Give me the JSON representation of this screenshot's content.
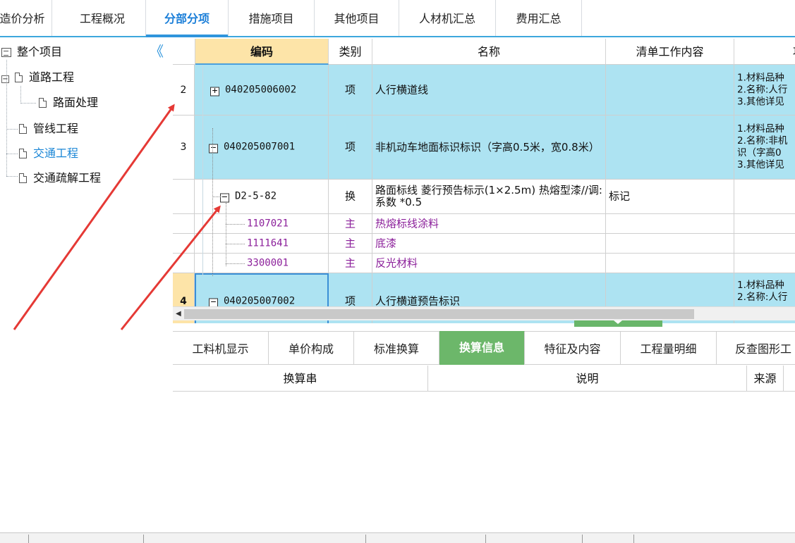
{
  "top_tabs": [
    {
      "label": "造价分析"
    },
    {
      "label": "工程概况"
    },
    {
      "label": "分部分项",
      "active": true
    },
    {
      "label": "措施项目"
    },
    {
      "label": "其他项目"
    },
    {
      "label": "人材机汇总"
    },
    {
      "label": "费用汇总"
    }
  ],
  "tree": {
    "collapse_glyph": "《",
    "root": "整个项目",
    "expander_minus": "−",
    "items": [
      {
        "label": "道路工程"
      },
      {
        "label": "路面处理"
      },
      {
        "label": "管线工程"
      },
      {
        "label": "交通工程",
        "selected": true
      },
      {
        "label": "交通疏解工程"
      }
    ]
  },
  "grid": {
    "headers": {
      "code": "编码",
      "type": "类别",
      "name": "名称",
      "content": "清单工作内容",
      "feature": "项"
    },
    "rows": [
      {
        "num": "2",
        "expander": "+",
        "code": "040205006002",
        "type": "项",
        "name": "人行横道线",
        "content": "",
        "feature": "1.材料品种\n2.名称:人行\n3.其他详见"
      },
      {
        "num": "3",
        "expander": "−",
        "code": "040205007001",
        "type": "项",
        "name": "非机动车地面标识标识（字高0.5米，宽0.8米）",
        "content": "",
        "feature": "1.材料品种\n2.名称:非机\n识（字高0\n3.其他详见"
      },
      {
        "num": "",
        "expander": "−",
        "code": "D2-5-82",
        "type": "换",
        "name": "路面标线 菱行预告标示(1×2.5m) 热熔型漆//调: 系数 *0.5",
        "content": "标记",
        "feature": ""
      },
      {
        "num": "",
        "code": "1107021",
        "type": "主",
        "name": "热熔标线涂料",
        "content": "",
        "feature": ""
      },
      {
        "num": "",
        "code": "1111641",
        "type": "主",
        "name": "底漆",
        "content": "",
        "feature": ""
      },
      {
        "num": "",
        "code": "3300001",
        "type": "主",
        "name": "反光材料",
        "content": "",
        "feature": ""
      },
      {
        "num": "4",
        "expander": "−",
        "code": "040205007002",
        "type": "项",
        "name": "人行横道预告标识",
        "content": "",
        "feature": "1.材料品种\n2.名称:人行"
      }
    ]
  },
  "scroll_arrow": "◀",
  "bottom_tabs": [
    {
      "label": "工料机显示"
    },
    {
      "label": "单价构成"
    },
    {
      "label": "标准换算"
    },
    {
      "label": "换算信息",
      "active": true
    },
    {
      "label": "特征及内容"
    },
    {
      "label": "工程量明细"
    },
    {
      "label": "反查图形工"
    }
  ],
  "conversion_table": {
    "headers": {
      "string": "换算串",
      "desc": "说明",
      "source": "来源"
    }
  },
  "colors": {
    "accent_blue": "#2f95dc",
    "row_highlight": "#ade3f2",
    "code_header": "#fde4a8",
    "active_tab_green": "#6cb76a",
    "annotation_arrow": "#e53935",
    "material_text": "#8b1f9a"
  }
}
